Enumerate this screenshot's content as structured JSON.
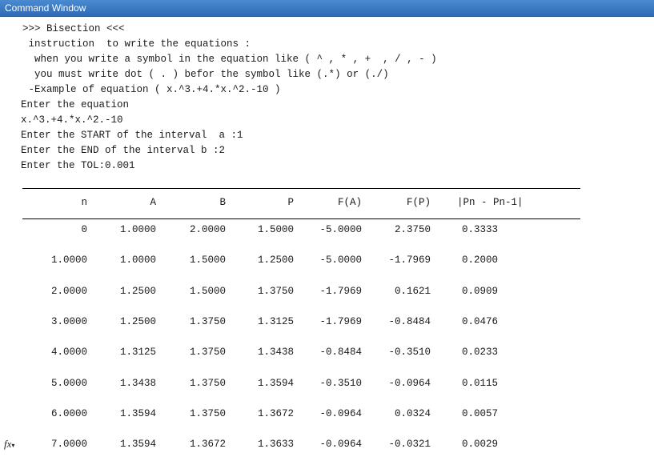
{
  "window": {
    "title": "Command Window"
  },
  "preamble": [
    ">>> Bisection <<<",
    " instruction  to write the equations :",
    "  when you write a symbol in the equation like ( ^ , * , +  , / , - )",
    "  you must write dot ( . ) befor the symbol like (.*) or (./)",
    " -Example of equation ( x.^3.+4.*x.^2.-10 )",
    "Enter the equation",
    "x.^3.+4.*x.^2.-10",
    "Enter the START of the interval  a :1",
    "Enter the END of the interval b :2",
    "Enter the TOL:0.001"
  ],
  "table": {
    "headers": [
      "n",
      "A",
      "B",
      "P",
      "F(A)",
      "F(P)",
      "|Pn - Pn-1|"
    ],
    "rows": [
      [
        "0",
        "1.0000",
        "2.0000",
        "1.5000",
        "-5.0000",
        "2.3750",
        "0.3333"
      ],
      [
        "1.0000",
        "1.0000",
        "1.5000",
        "1.2500",
        "-5.0000",
        "-1.7969",
        "0.2000"
      ],
      [
        "2.0000",
        "1.2500",
        "1.5000",
        "1.3750",
        "-1.7969",
        "0.1621",
        "0.0909"
      ],
      [
        "3.0000",
        "1.2500",
        "1.3750",
        "1.3125",
        "-1.7969",
        "-0.8484",
        "0.0476"
      ],
      [
        "4.0000",
        "1.3125",
        "1.3750",
        "1.3438",
        "-0.8484",
        "-0.3510",
        "0.0233"
      ],
      [
        "5.0000",
        "1.3438",
        "1.3750",
        "1.3594",
        "-0.3510",
        "-0.0964",
        "0.0115"
      ],
      [
        "6.0000",
        "1.3594",
        "1.3750",
        "1.3672",
        "-0.0964",
        "0.0324",
        "0.0057"
      ],
      [
        "7.0000",
        "1.3594",
        "1.3672",
        "1.3633",
        "-0.0964",
        "-0.0321",
        "0.0029"
      ]
    ]
  },
  "icons": {
    "prompt": "fx-icon"
  },
  "colors": {
    "titlebar": "#2e6cb6",
    "text": "#1a1a1a"
  }
}
